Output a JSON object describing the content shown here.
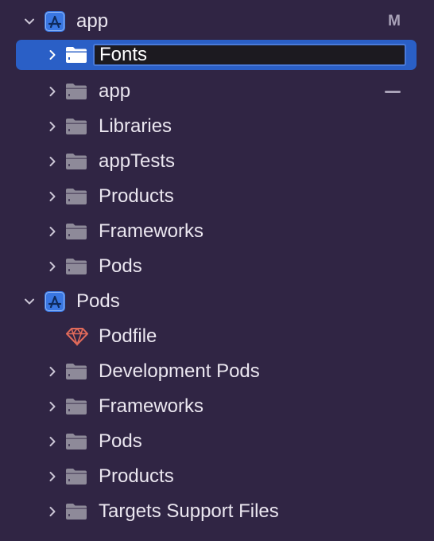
{
  "tree": {
    "app_project": {
      "label": "app",
      "badge": "M",
      "icon": "xcode-project-icon",
      "chevron": "chevron-down-icon"
    },
    "fonts_group": {
      "value": "Fonts",
      "icon": "folder-icon",
      "chevron": "chevron-right-icon"
    },
    "app_group": {
      "label": "app",
      "status": "dash",
      "icon": "folder-icon"
    },
    "libraries_group": {
      "label": "Libraries"
    },
    "apptests_group": {
      "label": "appTests"
    },
    "products_group_app": {
      "label": "Products"
    },
    "frameworks_group_app": {
      "label": "Frameworks"
    },
    "pods_group_app": {
      "label": "Pods"
    },
    "pods_project": {
      "label": "Pods",
      "icon": "xcode-project-icon",
      "chevron": "chevron-down-icon"
    },
    "podfile": {
      "label": "Podfile",
      "icon": "ruby-gem-icon"
    },
    "development_pods_group": {
      "label": "Development Pods"
    },
    "frameworks_group_pods": {
      "label": "Frameworks"
    },
    "pods_group_pods": {
      "label": "Pods"
    },
    "products_group_pods": {
      "label": "Products"
    },
    "targets_support_files_group": {
      "label": "Targets Support Files"
    }
  },
  "colors": {
    "background": "#302544",
    "selection": "#2a5fc6",
    "folder_gray": "#8e8a99",
    "project_blue": "#3a77e2",
    "podfile_red": "#e06a5a"
  }
}
